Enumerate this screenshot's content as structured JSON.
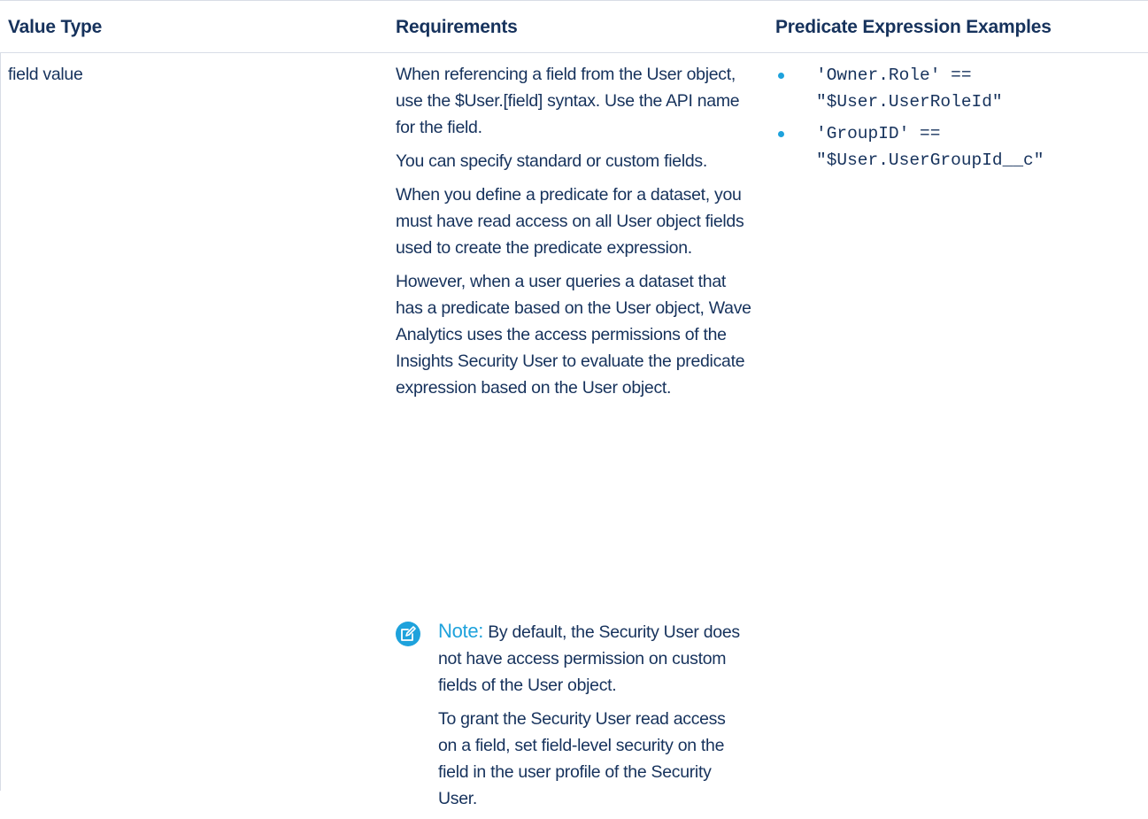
{
  "table": {
    "headers": [
      "Value Type",
      "Requirements",
      "Predicate Expression Examples"
    ],
    "rows": [
      {
        "value_type": "field value",
        "requirements": [
          "When referencing a field from the User object, use the $User.[field] syntax. Use the API name for the field.",
          "You can specify standard or custom fields.",
          "When you define a predicate for a dataset, you must have read access on all User object fields used to create the predicate expression.",
          "However, when a user queries a dataset that has a predicate based on the User object, Wave Analytics uses the access permissions of the Insights Security User to evaluate the predicate expression based on the User object."
        ],
        "note": {
          "label": "Note:",
          "text": "By default, the Security User does not have access permission on custom fields of the User object.",
          "text2": "To grant the Security User read access on a field, set field-level security on the field in the user profile of the Security User."
        },
        "examples": [
          {
            "line1": "'Owner.Role' ==",
            "line2": "\"$User.UserRoleId\""
          },
          {
            "line1": "'GroupID' ==",
            "line2": "\"$User.UserGroupId__c\""
          }
        ]
      }
    ]
  },
  "colors": {
    "text": "#16325c",
    "accent": "#1ea2dc",
    "border": "#d8dde6"
  },
  "icons": {
    "note": "edit-note-icon",
    "bullet": "bullet-dot-icon"
  }
}
